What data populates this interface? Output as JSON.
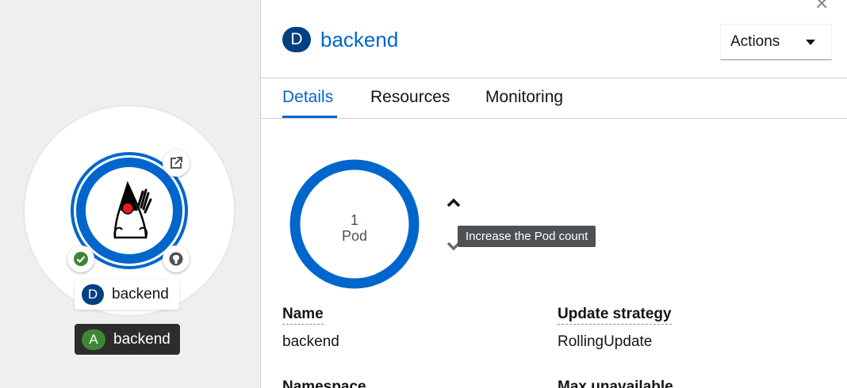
{
  "node": {
    "label_chip": "D",
    "label": "backend",
    "app_chip": "A",
    "app_label": "backend",
    "pod_status": "ok"
  },
  "panel": {
    "title_chip": "D",
    "title": "backend",
    "actions_label": "Actions",
    "tabs": [
      {
        "label": "Details",
        "active": true
      },
      {
        "label": "Resources",
        "active": false
      },
      {
        "label": "Monitoring",
        "active": false
      }
    ],
    "pod_count": "1",
    "pod_unit": "Pod",
    "tooltip": "Increase the Pod count",
    "details": {
      "name_term": "Name",
      "name_value": "backend",
      "update_term": "Update strategy",
      "update_value": "RollingUpdate",
      "namespace_term": "Namespace",
      "max_unavailable_term": "Max unavailable"
    }
  },
  "colors": {
    "accent": "#0066cc",
    "deployment_badge": "#004080",
    "app_badge": "#3e8635",
    "tooltip_bg": "#4f5255"
  }
}
